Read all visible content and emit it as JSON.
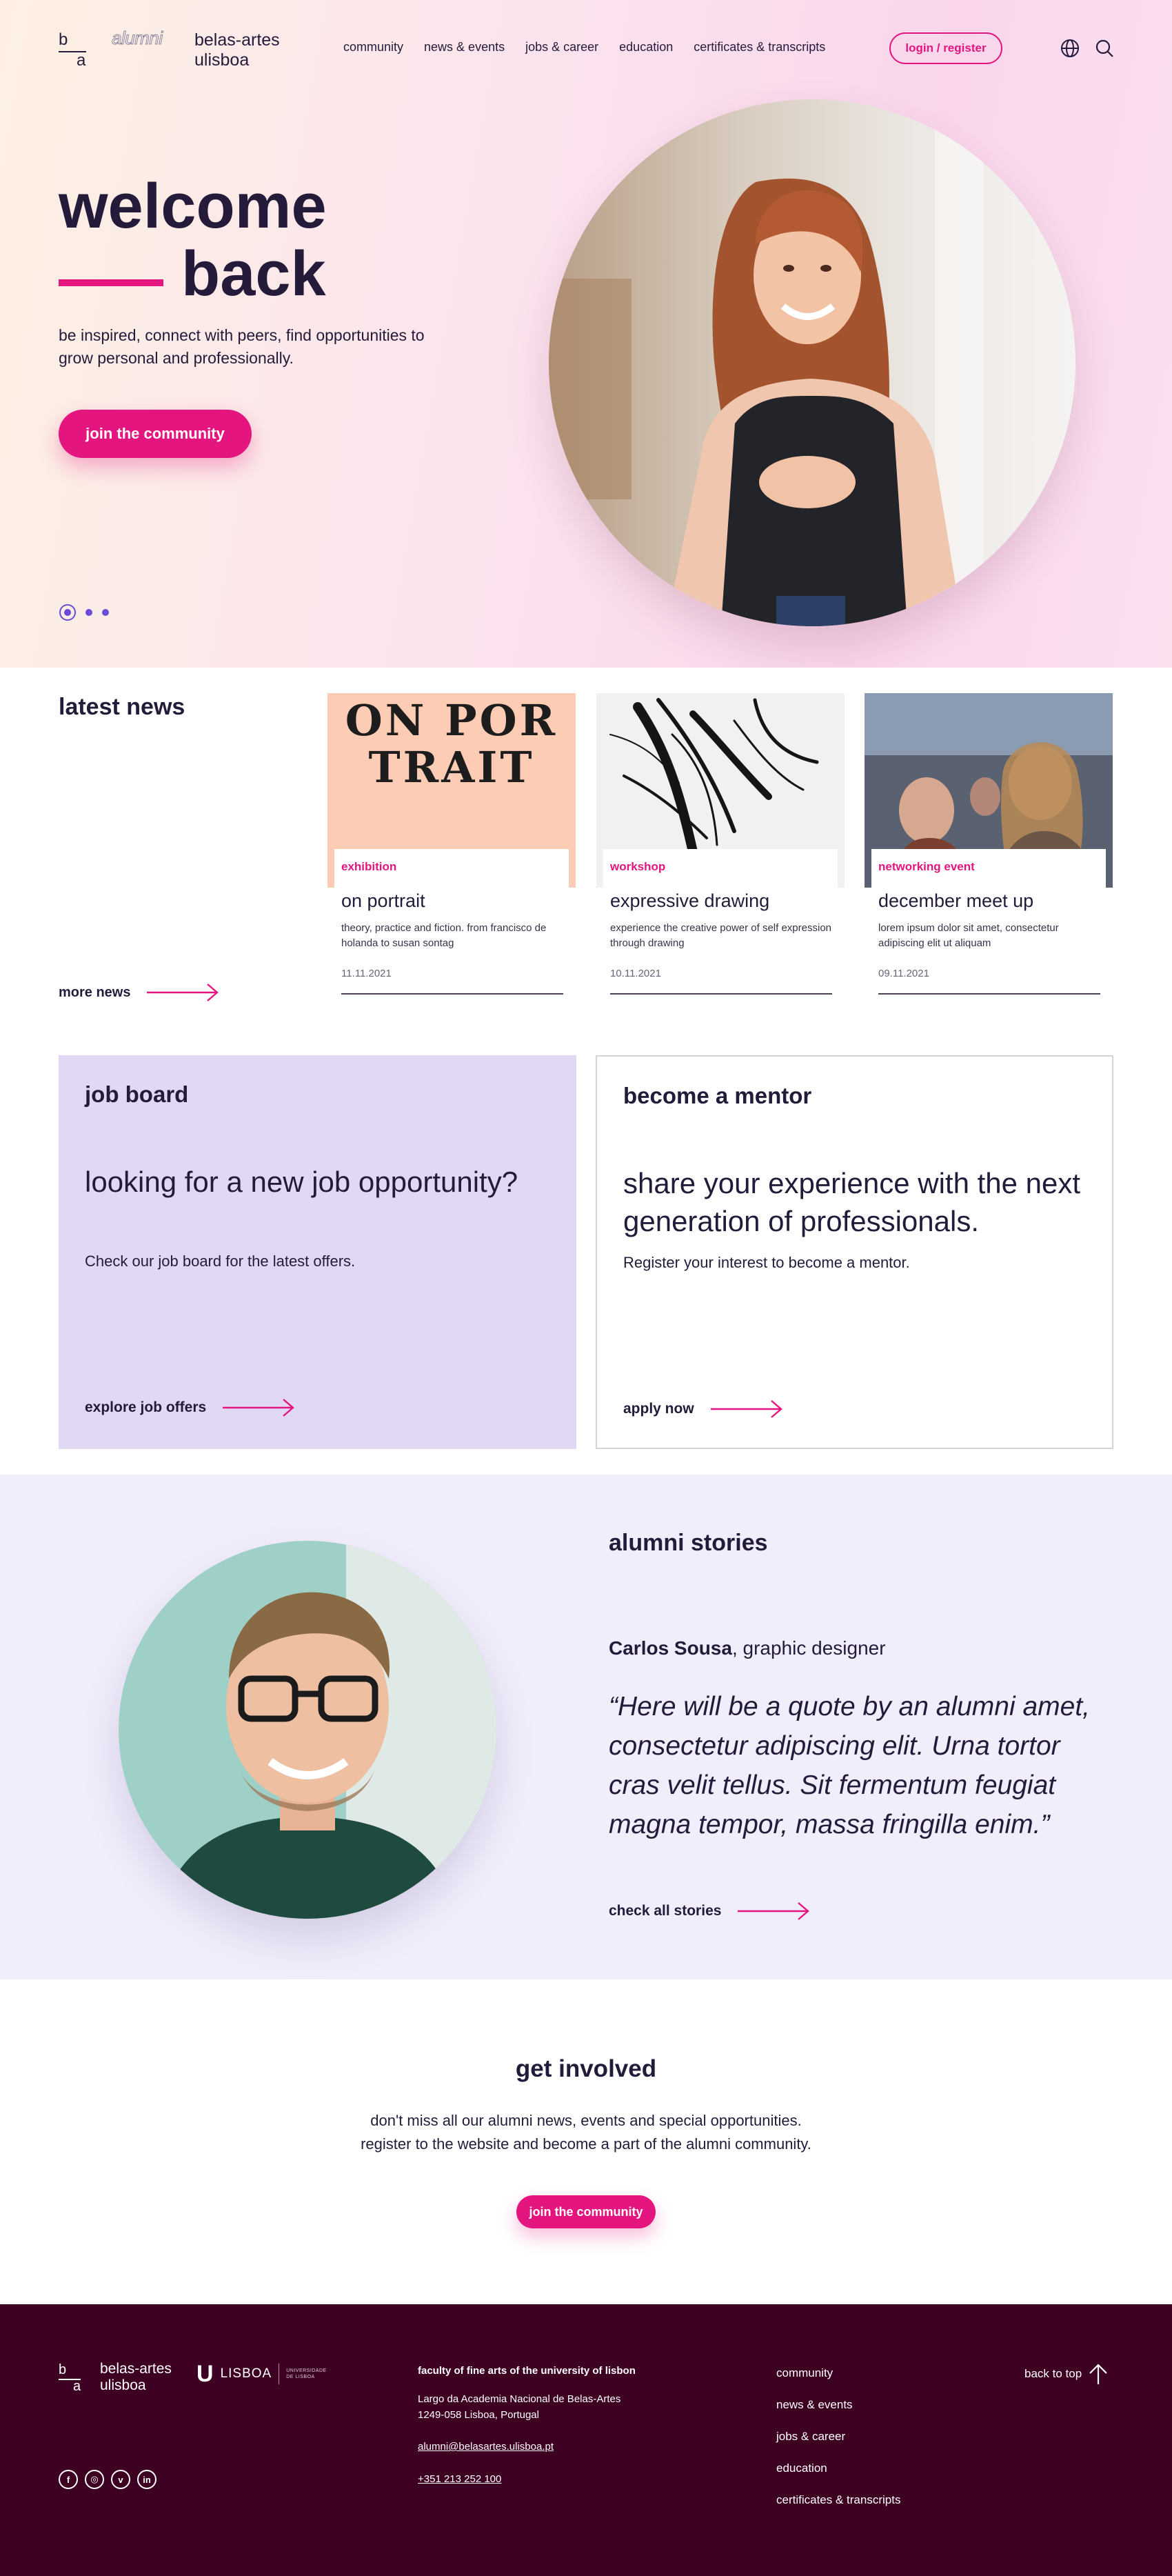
{
  "header": {
    "logo_b": "b",
    "logo_a": "a",
    "logo_alumni": "alumni",
    "institution": "belas-artes ulisboa",
    "nav": [
      "community",
      "news & events",
      "jobs & career",
      "education",
      "certificates & transcripts"
    ],
    "login_label": "login / register"
  },
  "hero": {
    "title_line1": "welcome",
    "title_line2": "back",
    "subtitle": "be inspired, connect with peers, find opportunities to grow personal and professionally.",
    "cta_label": "join the community",
    "slides_total": 3,
    "slide_active": 1
  },
  "news": {
    "title": "latest news",
    "more_label": "more news",
    "cards": [
      {
        "tag": "exhibition",
        "title": "on portrait",
        "desc": "theory, practice and fiction. from francisco de holanda to susan sontag",
        "date": "11.11.2021",
        "poster_line1": "ON POR",
        "poster_line2": "TRAIT"
      },
      {
        "tag": "workshop",
        "title": "expressive drawing",
        "desc": "experience the creative power of self expression through drawing",
        "date": "10.11.2021"
      },
      {
        "tag": "networking event",
        "title": "december meet up",
        "desc": "lorem ipsum dolor sit amet, consectetur adipiscing elit ut aliquam",
        "date": "09.11.2021"
      }
    ]
  },
  "job_board": {
    "title": "job board",
    "headline": "looking for a new job opportunity?",
    "sub": "Check our job board for the latest offers.",
    "link": "explore job offers"
  },
  "mentor": {
    "title": "become a mentor",
    "headline": "share your experience with the next generation of professionals.",
    "sub": "Register your interest to become a mentor.",
    "link": "apply now"
  },
  "stories": {
    "title": "alumni stories",
    "name": "Carlos Sousa",
    "role": ", graphic designer",
    "quote": "“Here will be a quote by an alumni amet, consectetur adipiscing elit. Urna tortor cras velit tellus. Sit fermentum feugiat magna tempor, massa fringilla enim.”",
    "link": "check all stories"
  },
  "get_involved": {
    "title": "get involved",
    "line1": "don't miss all our alumni news, events and special opportunities.",
    "line2": "register to the website and become a part of the alumni community.",
    "cta_label": "join the community"
  },
  "footer": {
    "logo_b": "b",
    "logo_a": "a",
    "institution": "belas-artes ulisboa",
    "ulisboa_u": "U",
    "ulisboa_name": "LISBOA",
    "ulisboa_small1": "UNIVERSIDADE",
    "ulisboa_small2": "DE LISBOA",
    "address_title": "faculty of fine arts of the university of lisbon",
    "address_line1": "Largo da Academia Nacional de Belas-Artes",
    "address_line2": "1249-058 Lisboa, Portugal",
    "email": "alumni@belasartes.ulisboa.pt",
    "phone": "+351 213 252 100",
    "links": [
      "community",
      "news & events",
      "jobs & career",
      "education",
      "certificates & transcripts"
    ],
    "back_to_top": "back to top",
    "social": [
      "facebook-icon",
      "instagram-icon",
      "vimeo-icon",
      "linkedin-icon"
    ]
  },
  "colors": {
    "accent": "#e5157f",
    "ink": "#241a3a",
    "job_panel": "#e1d9f3",
    "stories_bg": "#f1eefb",
    "footer_bg": "#3e0022",
    "dots": "#6a4bd3"
  }
}
